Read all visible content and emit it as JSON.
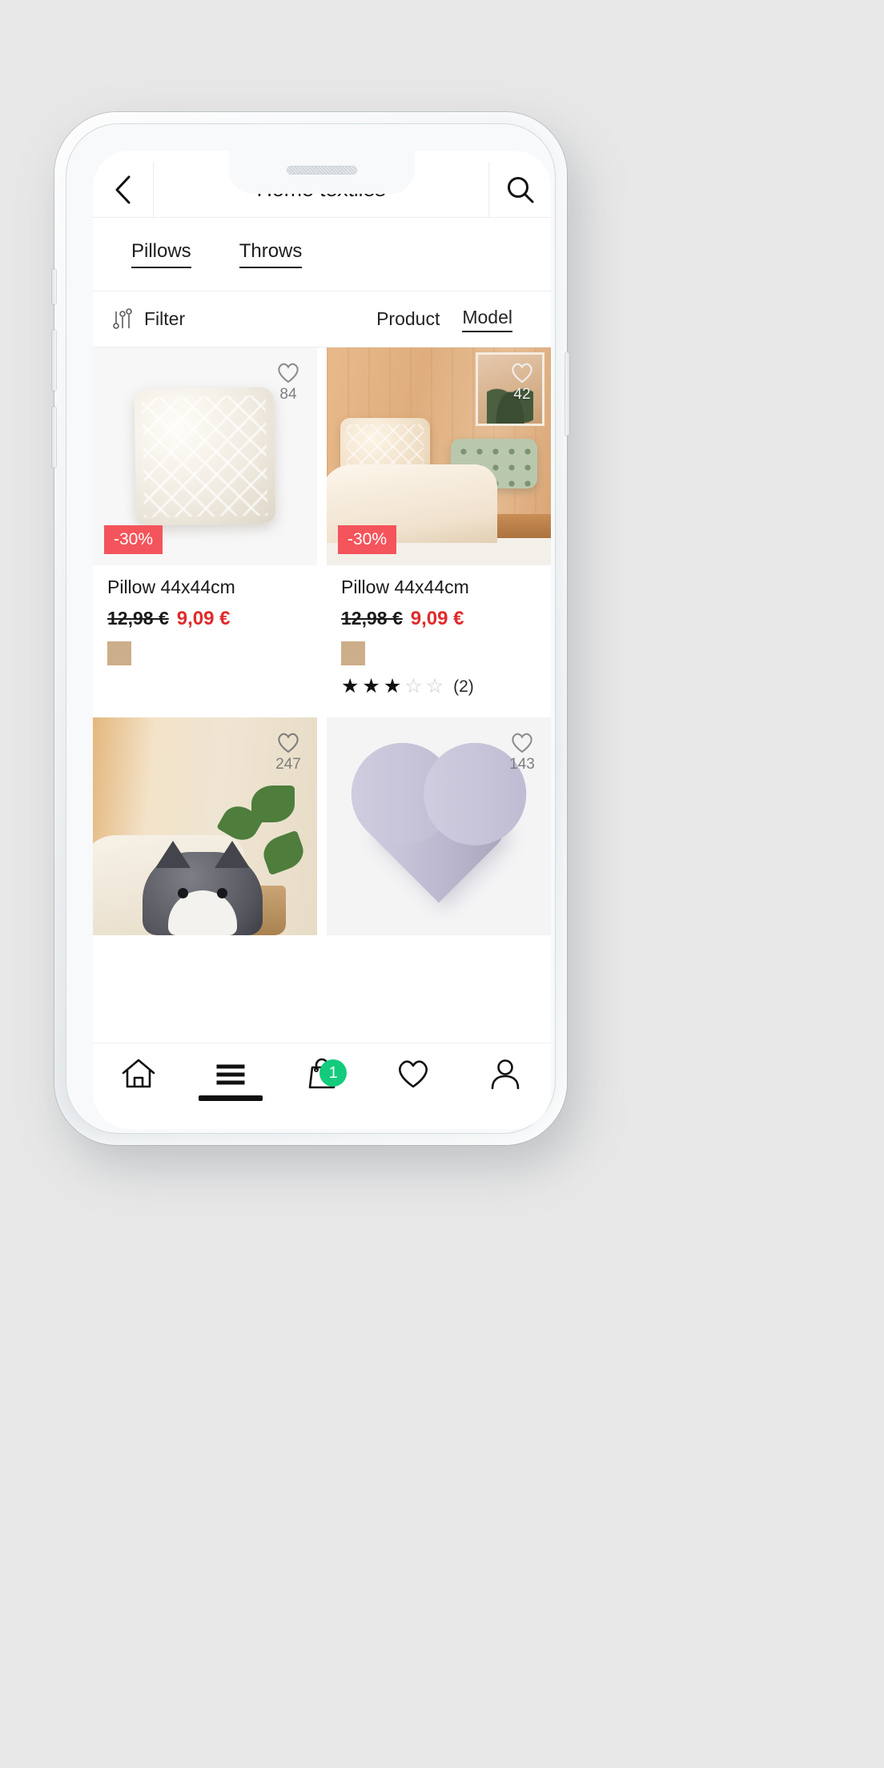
{
  "header": {
    "title": "Home textiles",
    "back_icon": "chevron-left-icon",
    "search_icon": "search-icon"
  },
  "tabs": [
    {
      "label": "Pillows"
    },
    {
      "label": "Throws"
    }
  ],
  "filter_bar": {
    "filter_label": "Filter",
    "filter_icon": "sliders-icon",
    "sort_options": [
      {
        "label": "Product",
        "active": false
      },
      {
        "label": "Model",
        "active": true
      }
    ]
  },
  "products": [
    {
      "image_kind": "pillow-plain",
      "favorite_count": "84",
      "discount": "-30%",
      "title": "Pillow 44x44cm",
      "price_old": "12,98 €",
      "price_new": "9,09 €",
      "swatch_color": "#cdae8a",
      "rating": null,
      "rating_count": null
    },
    {
      "image_kind": "bedroom",
      "favorite_count": "42",
      "discount": "-30%",
      "title": "Pillow 44x44cm",
      "price_old": "12,98 €",
      "price_new": "9,09 €",
      "swatch_color": "#cdae8a",
      "rating": 3,
      "rating_count": "(2)"
    },
    {
      "image_kind": "cat-pillow",
      "favorite_count": "247",
      "discount": null,
      "title": null,
      "price_old": null,
      "price_new": null,
      "swatch_color": null,
      "rating": null,
      "rating_count": null
    },
    {
      "image_kind": "heart-pillow",
      "favorite_count": "143",
      "discount": null,
      "title": null,
      "price_old": null,
      "price_new": null,
      "swatch_color": null,
      "rating": null,
      "rating_count": null
    }
  ],
  "bottom_nav": [
    {
      "icon": "home-icon",
      "active": false
    },
    {
      "icon": "menu-icon",
      "active": true
    },
    {
      "icon": "shopping-bag-icon",
      "active": false,
      "badge": "1"
    },
    {
      "icon": "heart-icon",
      "active": false
    },
    {
      "icon": "user-icon",
      "active": false
    }
  ],
  "colors": {
    "discount_red": "#f4545b",
    "price_red": "#e02b2b",
    "badge_green": "#12cb7c",
    "swatch_tan": "#cdae8a"
  }
}
